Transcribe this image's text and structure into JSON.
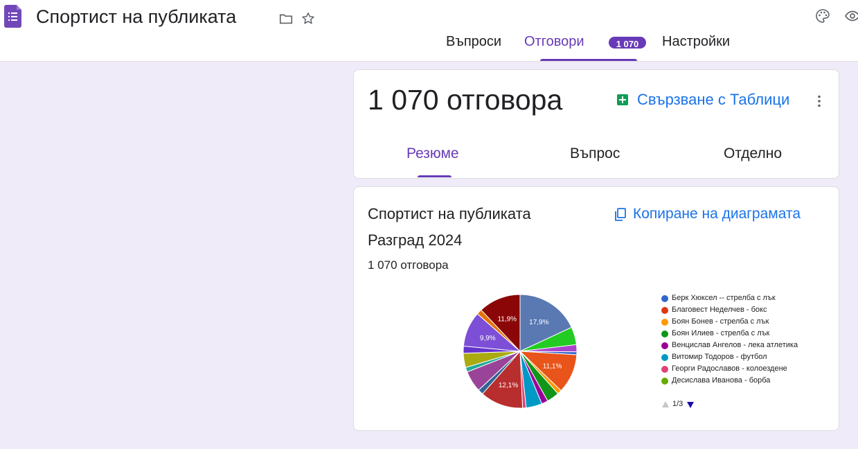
{
  "header": {
    "title": "Спортист на публиката",
    "icons": [
      "forms-app-icon",
      "folder-icon",
      "star-icon",
      "palette-icon",
      "eye-icon"
    ]
  },
  "nav": {
    "tabs": [
      {
        "label": "Въпроси",
        "active": false
      },
      {
        "label": "Отговори",
        "active": true,
        "badge": "1 070"
      },
      {
        "label": "Настройки",
        "active": false
      }
    ]
  },
  "responses": {
    "count_label": "1 070 отговора",
    "link_sheets": "Свързване с Таблици",
    "subtabs": [
      {
        "label": "Резюме",
        "active": true
      },
      {
        "label": "Въпрос",
        "active": false
      },
      {
        "label": "Отделно",
        "active": false
      }
    ]
  },
  "question": {
    "title": "Спортист на публиката Разград 2024",
    "copy_chart": "Копиране на диаграмата",
    "count": "1 070 отговора"
  },
  "legend": {
    "items": [
      {
        "label": "Берк Хюксел -- стрелба с лък",
        "color": "#3366cc"
      },
      {
        "label": "Благовест Неделчев - бокс",
        "color": "#dc3912"
      },
      {
        "label": "Боян Бонев - стрелба с лък",
        "color": "#ff9900"
      },
      {
        "label": "Боян Илиев - стрелба с лък",
        "color": "#109618"
      },
      {
        "label": "Венцислав Ангелов - лека атлетика",
        "color": "#990099"
      },
      {
        "label": "Витомир Тодоров - футбол",
        "color": "#0099c6"
      },
      {
        "label": "Георги Радославов - колоездене",
        "color": "#dd4477"
      },
      {
        "label": "Десислава Иванова - борба",
        "color": "#66aa00"
      }
    ],
    "page": "1/3"
  },
  "chart_data": {
    "type": "pie",
    "slices": [
      {
        "value": 17.9,
        "color": "#5a79b3",
        "label": "17,9%"
      },
      {
        "value": 5.0,
        "color": "#22cc22",
        "label": ""
      },
      {
        "value": 2.0,
        "color": "#aa44cc",
        "label": ""
      },
      {
        "value": 0.8,
        "color": "#3366cc",
        "label": ""
      },
      {
        "value": 11.1,
        "color": "#e8541a",
        "label": "11,1%"
      },
      {
        "value": 1.2,
        "color": "#ff9900",
        "label": ""
      },
      {
        "value": 3.5,
        "color": "#109618",
        "label": ""
      },
      {
        "value": 1.8,
        "color": "#990099",
        "label": ""
      },
      {
        "value": 4.5,
        "color": "#0099c6",
        "label": ""
      },
      {
        "value": 1.0,
        "color": "#dd4477",
        "label": ""
      },
      {
        "value": 12.1,
        "color": "#b82e2e",
        "label": "12,1%"
      },
      {
        "value": 1.5,
        "color": "#316395",
        "label": ""
      },
      {
        "value": 6.0,
        "color": "#994499",
        "label": ""
      },
      {
        "value": 1.3,
        "color": "#22aa99",
        "label": ""
      },
      {
        "value": 4.0,
        "color": "#aaaa11",
        "label": ""
      },
      {
        "value": 2.0,
        "color": "#6633cc",
        "label": ""
      },
      {
        "value": 9.9,
        "color": "#7d4fd6",
        "label": "9,9%"
      },
      {
        "value": 1.5,
        "color": "#e67300",
        "label": ""
      },
      {
        "value": 11.9,
        "color": "#8b0707",
        "label": "11,9%"
      }
    ]
  }
}
